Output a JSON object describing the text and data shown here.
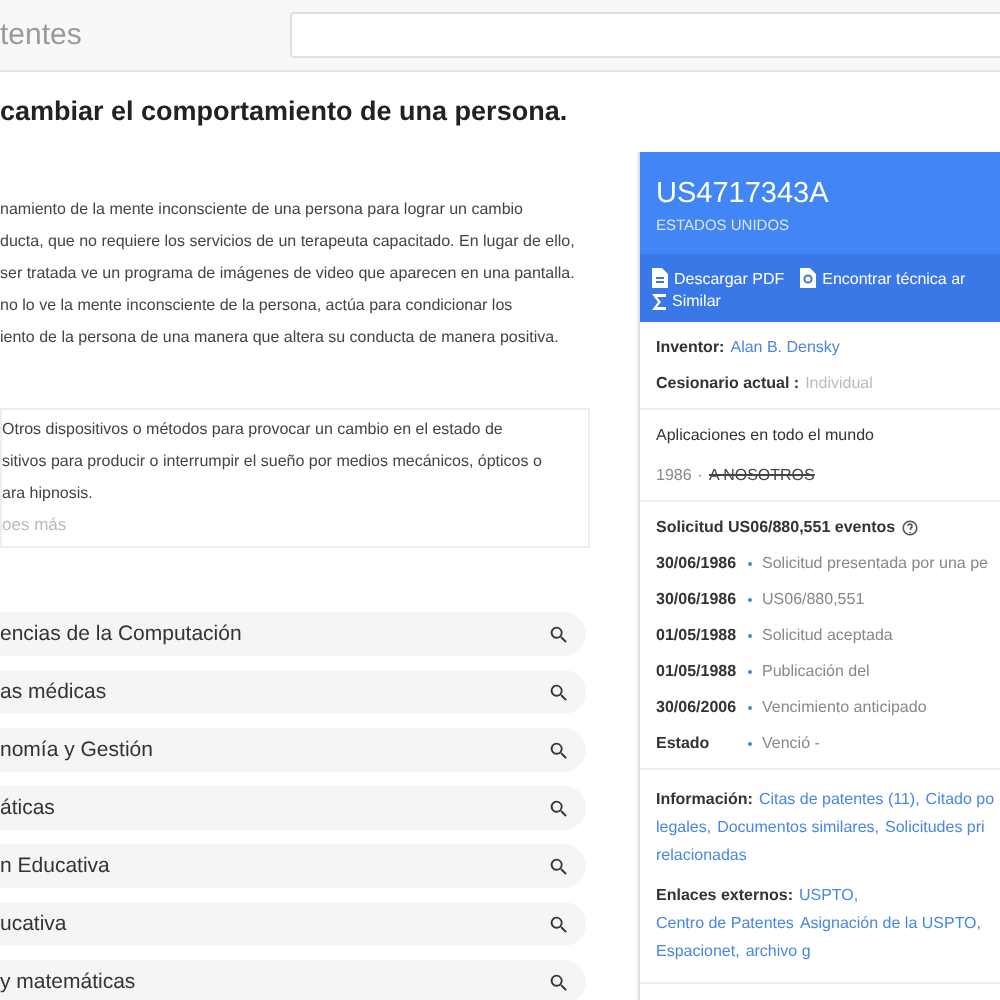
{
  "header": {
    "brand": "tentes",
    "search": {
      "kind": "field"
    }
  },
  "title": "cambiar el comportamiento de una persona.",
  "abstract": [
    "namiento de la mente inconsciente de una persona para lograr un cambio",
    "ducta, que no requiere los servicios de un terapeuta capacitado. En lugar de ello,",
    "ser tratada ve un programa de imágenes de video que aparecen en una pantalla.",
    "no lo ve la mente inconsciente de la persona, actúa para condicionar los",
    "iento de la persona de una manera que altera su conducta de manera positiva."
  ],
  "classification": {
    "lines": [
      "Otros dispositivos o métodos para provocar un cambio en el estado de",
      "sitivos para producir o interrumpir el sueño por medios mecánicos, ópticos o",
      "ara hipnosis."
    ],
    "more": "oes más"
  },
  "concepts": [
    "encias de la Computación",
    "as médicas",
    "nomía y Gestión",
    "áticas",
    "n Educativa",
    "ucativa",
    "y matemáticas"
  ],
  "card": {
    "number": "US4717343A",
    "country": "ESTADOS UNIDOS",
    "actions": [
      {
        "kind": "pdf",
        "label": "Descargar PDF"
      },
      {
        "kind": "search",
        "label": "Encontrar técnica ar"
      },
      {
        "kind": "sigma",
        "label": "Similar"
      }
    ],
    "inventor": {
      "label": "Inventor:",
      "value": "Alan B. Densky"
    },
    "assignee": {
      "label": "Cesionario actual :",
      "value": "Individual"
    },
    "worldwide": {
      "title": "Aplicaciones en todo el mundo",
      "year": "1986",
      "separator": "·",
      "country": "A NOSOTROS"
    },
    "events_title": "Solicitud US06/880,551 eventos",
    "events": [
      {
        "date": "30/06/1986",
        "text": "Solicitud presentada por una pe"
      },
      {
        "date": "30/06/1986",
        "text": "US06/880,551"
      },
      {
        "date": "01/05/1988",
        "text": "Solicitud aceptada"
      },
      {
        "date": "01/05/1988",
        "text": "Publicación del"
      },
      {
        "date": "30/06/2006",
        "text": "Vencimiento anticipado"
      },
      {
        "date": "Estado",
        "text": "Venció -"
      }
    ],
    "info": {
      "label": "Información:",
      "links": [
        "Citas de patentes (11),",
        "Citado po",
        "legales,",
        "Documentos similares,",
        "Solicitudes pri",
        "relacionadas"
      ]
    },
    "external": {
      "label": "Enlaces externos:",
      "links": [
        "USPTO,",
        "Centro de Patentes",
        "Asignación de la USPTO,",
        "Espacionet,",
        "archivo g"
      ]
    }
  }
}
